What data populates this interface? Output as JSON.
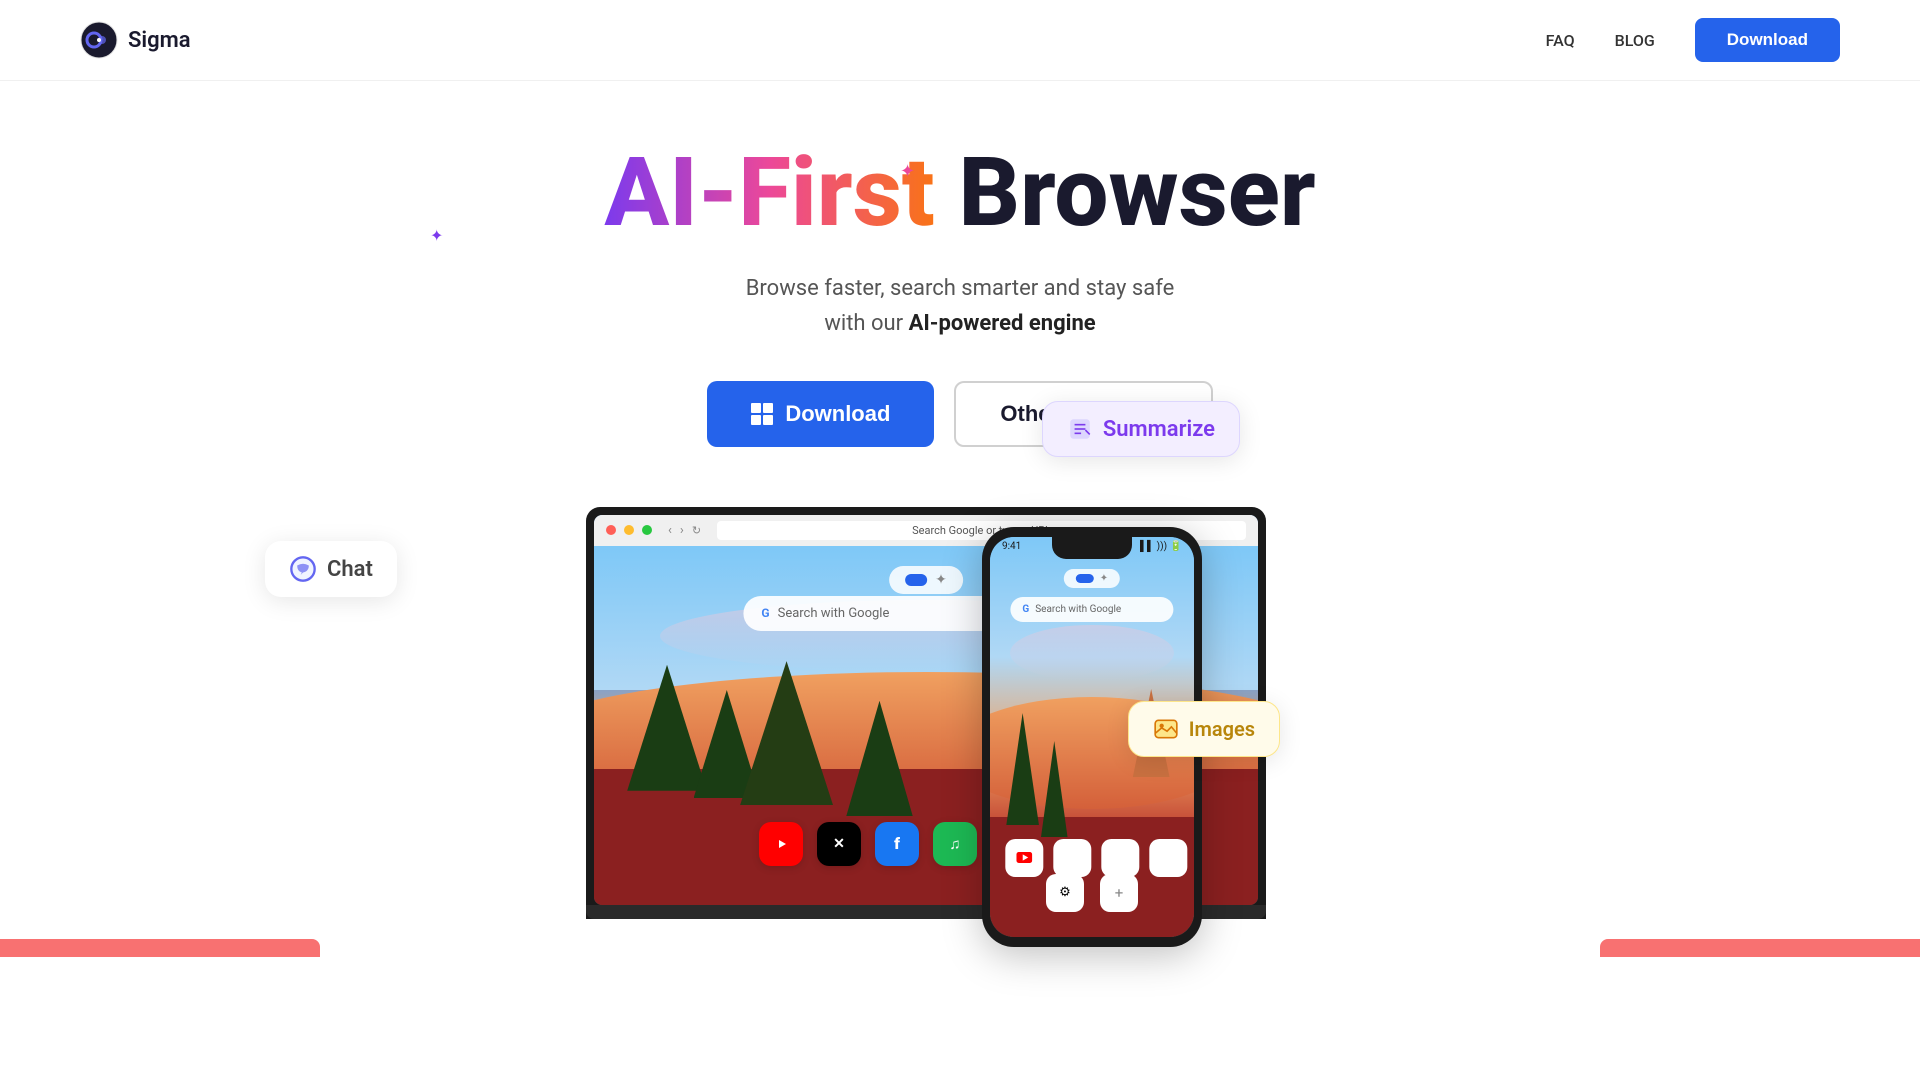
{
  "brand": {
    "name": "Sigma",
    "logo_alt": "Sigma logo"
  },
  "nav": {
    "faq_label": "FAQ",
    "blog_label": "BLOG",
    "download_label": "Download"
  },
  "hero": {
    "title_gradient": "AI-First",
    "title_normal": "Browser",
    "subtitle_line1": "Browse faster, search smarter and stay safe",
    "subtitle_line2_normal": "with our ",
    "subtitle_line2_bold": "AI-powered engine",
    "cta_download": "Download",
    "cta_other_platforms": "Other Platforms"
  },
  "badges": {
    "chat_label": "Chat",
    "summarize_label": "Summarize",
    "images_label": "Images"
  },
  "laptop": {
    "address": "Search Google or type a URL",
    "search_placeholder": "Search with Google"
  },
  "phone": {
    "time": "9:41",
    "search_placeholder": "Search with Google"
  }
}
